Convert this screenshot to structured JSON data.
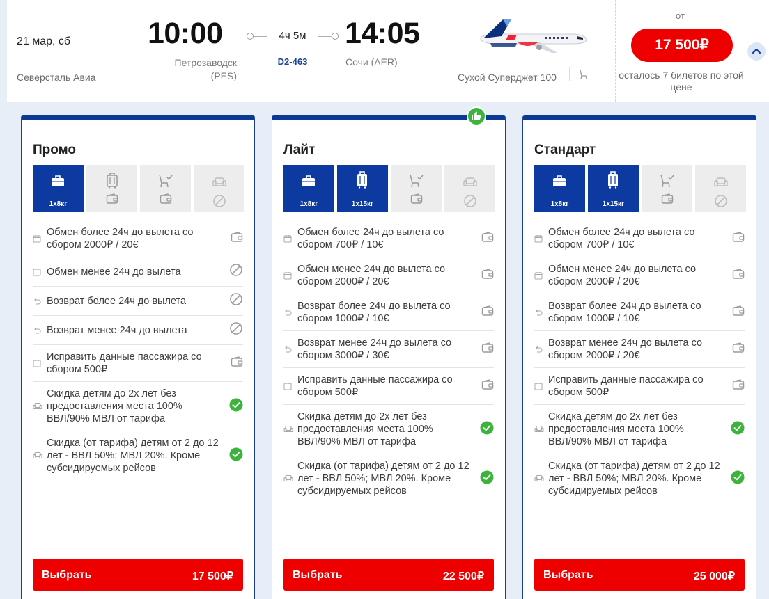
{
  "flight": {
    "date": "21 мар, сб",
    "airline": "Северсталь Авиа",
    "departure": {
      "time": "10:00",
      "city": "Петрозаводск",
      "code": "(PES)"
    },
    "duration": "4ч 5м",
    "flight_number": "D2-463",
    "arrival": {
      "time": "14:05",
      "city": "Сочи (AER)"
    },
    "aircraft": "Сухой Суперджет 100",
    "price_from_label": "от",
    "price": "17 500₽",
    "seats_left": "осталось 7 билетов по этой цене"
  },
  "colors": {
    "accent_red": "#ee0000",
    "brand_blue": "#0c3aa1",
    "ok_green": "#3cb43c"
  },
  "tariffs": [
    {
      "title": "Промо",
      "tiles": [
        {
          "icon": "hand-luggage-icon",
          "label": "1x8кг",
          "active": true
        },
        {
          "icon": "baggage-paid-icon",
          "label": "",
          "active": false
        },
        {
          "icon": "seat-choice-paid-icon",
          "label": "",
          "active": false
        },
        {
          "icon": "comfort-unavailable-icon",
          "label": "",
          "active": false
        }
      ],
      "rules": [
        {
          "icon": "calendar-icon",
          "text": "Обмен более 24ч до вылета со сбором 2000₽ / 20€",
          "status": "paid"
        },
        {
          "icon": "calendar-icon",
          "text": "Обмен менее 24ч до вылета",
          "status": "unavailable"
        },
        {
          "icon": "refund-icon",
          "text": "Возврат более 24ч до вылета",
          "status": "unavailable"
        },
        {
          "icon": "refund-icon",
          "text": "Возврат менее 24ч до вылета",
          "status": "unavailable"
        },
        {
          "icon": "calendar-icon",
          "text": "Исправить данные пассажира со сбором 500₽",
          "status": "paid"
        },
        {
          "icon": "child-seat-icon",
          "text": "Скидка детям до 2х лет без предоставления места 100% ВВЛ/90% МВЛ от тарифа",
          "status": "included"
        },
        {
          "icon": "child-seat-icon",
          "text": "Скидка (от тарифа) детям от 2 до 12 лет - ВВЛ 50%; МВЛ 20%. Кроме субсидируемых рейсов",
          "status": "included"
        }
      ],
      "button_label": "Выбрать",
      "button_price": "17 500₽"
    },
    {
      "title": "Лайт",
      "tiles": [
        {
          "icon": "hand-luggage-icon",
          "label": "1x8кг",
          "active": true
        },
        {
          "icon": "suitcase-icon",
          "label": "1x15кг",
          "active": true
        },
        {
          "icon": "seat-choice-paid-icon",
          "label": "",
          "active": false
        },
        {
          "icon": "comfort-unavailable-icon",
          "label": "",
          "active": false
        }
      ],
      "rules": [
        {
          "icon": "calendar-icon",
          "text": "Обмен более 24ч до вылета со сбором 700₽ / 10€",
          "status": "paid"
        },
        {
          "icon": "calendar-icon",
          "text": "Обмен менее 24ч до вылета со сбором 2000₽ / 20€",
          "status": "paid"
        },
        {
          "icon": "refund-icon",
          "text": "Возврат более 24ч до вылета со сбором 1000₽ / 10€",
          "status": "paid"
        },
        {
          "icon": "refund-icon",
          "text": "Возврат менее 24ч до вылета со сбором 3000₽ / 30€",
          "status": "paid"
        },
        {
          "icon": "calendar-icon",
          "text": "Исправить данные пассажира со сбором 500₽",
          "status": "paid"
        },
        {
          "icon": "child-seat-icon",
          "text": "Скидка детям до 2х лет без предоставления места 100% ВВЛ/90% МВЛ от тарифа",
          "status": "included"
        },
        {
          "icon": "child-seat-icon",
          "text": "Скидка (от тарифа) детям от 2 до 12 лет - ВВЛ 50%; МВЛ 20%. Кроме субсидируемых рейсов",
          "status": "included"
        }
      ],
      "button_label": "Выбрать",
      "button_price": "22 500₽"
    },
    {
      "title": "Стандарт",
      "tiles": [
        {
          "icon": "hand-luggage-icon",
          "label": "1x8кг",
          "active": true
        },
        {
          "icon": "suitcase-icon",
          "label": "1x15кг",
          "active": true
        },
        {
          "icon": "seat-choice-paid-icon",
          "label": "",
          "active": false
        },
        {
          "icon": "comfort-unavailable-icon",
          "label": "",
          "active": false
        }
      ],
      "rules": [
        {
          "icon": "calendar-icon",
          "text": "Обмен более 24ч до вылета со сбором 700₽ / 10€",
          "status": "paid"
        },
        {
          "icon": "calendar-icon",
          "text": "Обмен менее 24ч до вылета со сбором 2000₽ / 20€",
          "status": "paid"
        },
        {
          "icon": "refund-icon",
          "text": "Возврат более 24ч до вылета со сбором 1000₽ / 10€",
          "status": "paid"
        },
        {
          "icon": "refund-icon",
          "text": "Возврат менее 24ч до вылета со сбором 2000₽ / 20€",
          "status": "paid"
        },
        {
          "icon": "calendar-icon",
          "text": "Исправить данные пассажира со сбором 500₽",
          "status": "paid"
        },
        {
          "icon": "child-seat-icon",
          "text": "Скидка детям до 2х лет без предоставления места 100% ВВЛ/90% МВЛ от тарифа",
          "status": "included"
        },
        {
          "icon": "child-seat-icon",
          "text": "Скидка (от тарифа) детям от 2 до 12 лет - ВВЛ 50%; МВЛ 20%. Кроме субсидируемых рейсов",
          "status": "included"
        }
      ],
      "button_label": "Выбрать",
      "button_price": "25 000₽"
    }
  ]
}
